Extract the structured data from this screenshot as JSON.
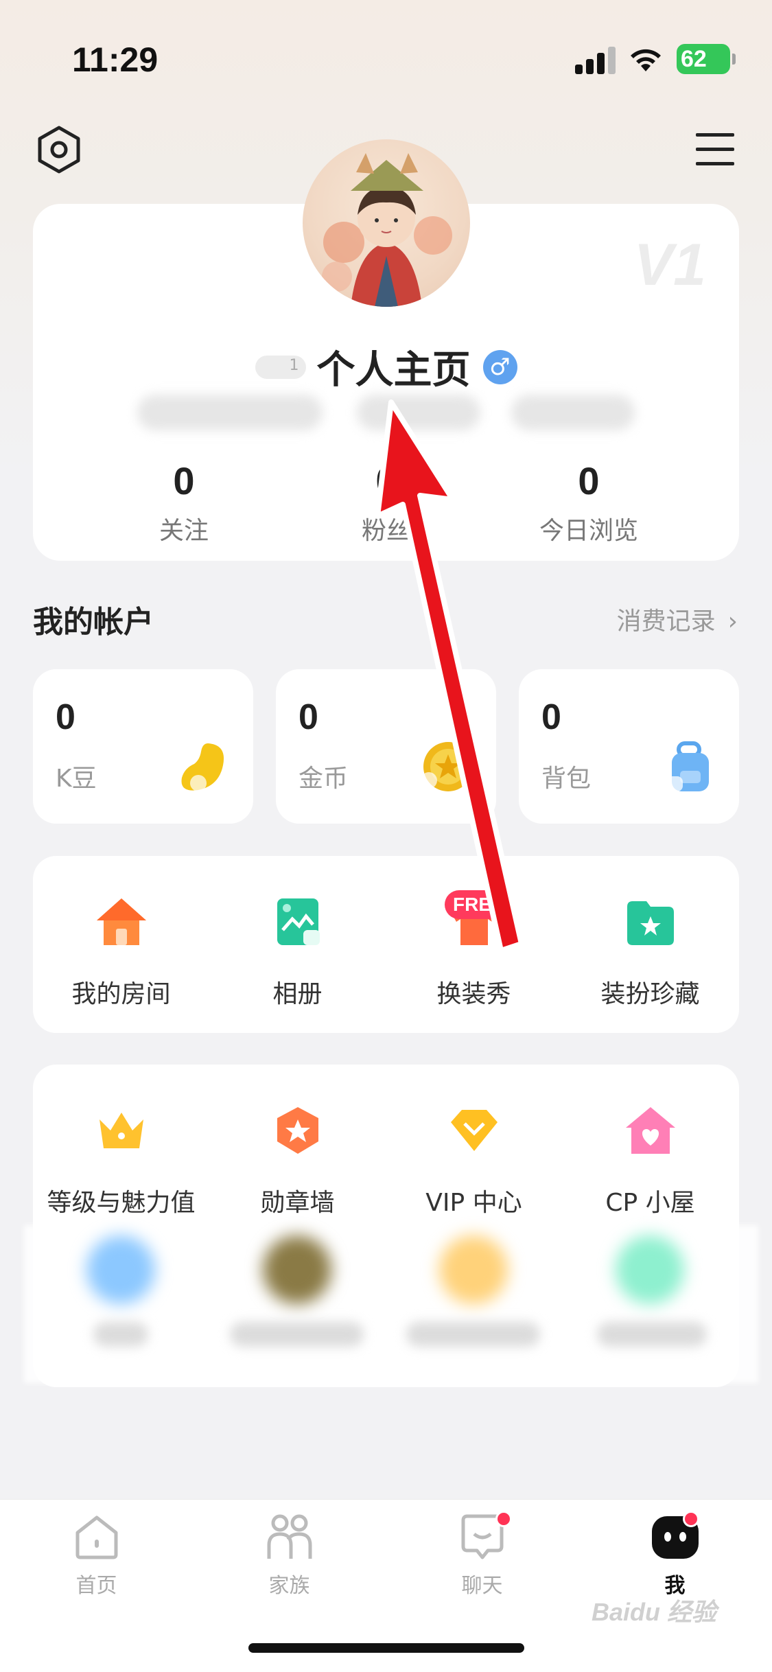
{
  "status_bar": {
    "time": "11:29",
    "battery": "62"
  },
  "profile": {
    "level_badge_text": "1",
    "name": "个人主页",
    "gender_symbol": "♂",
    "vip_badge": "V1",
    "stats": [
      {
        "value": "0",
        "label": "关注"
      },
      {
        "value": "0",
        "label": "粉丝"
      },
      {
        "value": "0",
        "label": "今日浏览"
      }
    ]
  },
  "account": {
    "title": "我的帐户",
    "link": "消费记录",
    "items": [
      {
        "value": "0",
        "label": "K豆",
        "icon": "bean-icon"
      },
      {
        "value": "0",
        "label": "金币",
        "icon": "coin-icon"
      },
      {
        "value": "0",
        "label": "背包",
        "icon": "backpack-icon"
      }
    ]
  },
  "features": {
    "new_badge": "FREE",
    "items": [
      {
        "label": "我的房间",
        "icon": "house-icon"
      },
      {
        "label": "相册",
        "icon": "album-icon"
      },
      {
        "label": "换装秀",
        "icon": "tshirt-icon"
      },
      {
        "label": "装扮珍藏",
        "icon": "folder-icon"
      }
    ]
  },
  "more": {
    "items": [
      {
        "label": "等级与魅力值",
        "icon": "crown-icon"
      },
      {
        "label": "勋章墙",
        "icon": "medal-icon"
      },
      {
        "label": "VIP 中心",
        "icon": "diamond-icon"
      },
      {
        "label": "CP 小屋",
        "icon": "heart-house-icon"
      }
    ]
  },
  "tabs": [
    {
      "label": "首页",
      "icon": "home-tab-icon"
    },
    {
      "label": "家族",
      "icon": "family-tab-icon"
    },
    {
      "label": "聊天",
      "icon": "chat-tab-icon"
    },
    {
      "label": "我",
      "icon": "me-tab-icon"
    }
  ],
  "watermark": "Baidu 经验",
  "colors": {
    "accent_red": "#ff3355",
    "arrow_red": "#e8141c",
    "gender_blue": "#5fa2ef"
  }
}
